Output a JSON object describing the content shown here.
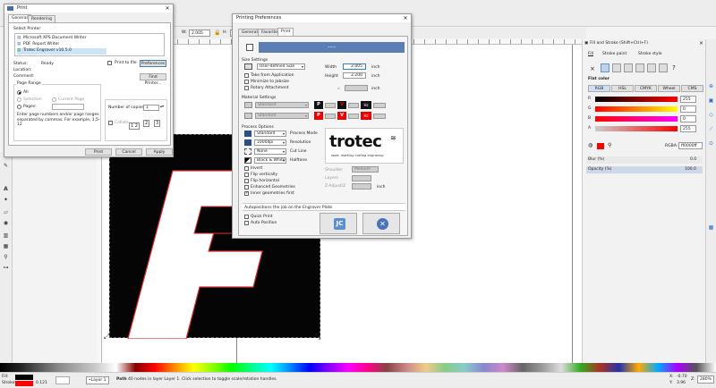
{
  "editor": {
    "toolbar": {
      "w_label": "W:",
      "w_value": "2.005"
    },
    "statusbar": {
      "fill_label": "Fill:",
      "stroke_label": "Stroke:",
      "stroke_width": "0.121",
      "layer": "•Layer 1",
      "message_bold": "Path",
      "message": " 40 nodes in layer Layer 1. Click selection to toggle scale/rotation handles.",
      "x_label": "X:",
      "x_value": "-0.70",
      "y_label": "Y:",
      "y_value": "3.96",
      "z_label": "Z:",
      "zoom": "280%"
    }
  },
  "print_dialog": {
    "title": "Print",
    "tabs": [
      "General",
      "Rendering"
    ],
    "select_printer_label": "Select Printer",
    "printers": [
      {
        "name": "Microsoft XPS Document Writer"
      },
      {
        "name": "PDF Report Writer"
      },
      {
        "name": "Trotec Engraver v10.5.0"
      }
    ],
    "status_label": "Status:",
    "status_value": "Ready",
    "location_label": "Location:",
    "comment_label": "Comment:",
    "print_to_file": "Print to file",
    "preferences_btn": "Preferences",
    "find_printer_btn": "Find Printer...",
    "page_range_label": "Page Range",
    "range_all": "All",
    "range_selection": "Selection",
    "range_current": "Current Page",
    "range_pages": "Pages:",
    "range_help": "Enter page numbers and/or page ranges separated by commas.  For example, 1,5-12",
    "copies_label": "Number of copies:",
    "copies_value": "1",
    "collate_label": "Collate",
    "print_btn": "Print",
    "cancel_btn": "Cancel",
    "apply_btn": "Apply"
  },
  "prefs_dialog": {
    "title": "Printing Preferences",
    "tabs": [
      "General",
      "Favorites",
      "Print"
    ],
    "size_settings_label": "Size Settings",
    "size_mode": "User-defined Size",
    "width_label": "Width",
    "width_value": "2.005",
    "width_unit": "inch",
    "height_label": "Height",
    "height_value": "2.200",
    "height_unit": "inch",
    "take_from_app": "Take from Application",
    "minimize_jobsize": "Minimize to Jobsize",
    "rotary_attachment": "Rotary Attachment",
    "rotary_unit": "inch",
    "material_settings_label": "Material Settings",
    "material_1": "Standard",
    "material_2": "Standard",
    "process_options_label": "Process Options",
    "process_mode_value": "Standard",
    "process_mode_label": "Process Mode",
    "resolution_value": "1000dpi",
    "resolution_label": "Resolution",
    "cut_line_value": "None",
    "cut_line_label": "Cut Line",
    "halftone_value": "Black & White",
    "halftone_label": "Halftone",
    "invert": "Invert",
    "flip_vertically": "Flip vertically",
    "flip_horizontal": "Flip horizontal",
    "enhanced_geometries": "Enhanced Geometries",
    "inner_geometries_first": "Inner geometries first",
    "shoulder_label": "Shoulder",
    "shoulder_value": "Medium",
    "layers_label": "Layers",
    "z_offset_label": "Z-Adjust/Z",
    "z_offset_unit": "inch",
    "logo_text": "trotec",
    "logo_tagline": "laser. marking cutting engraving",
    "autoposition_label": "Autopositions the job on the Engraver Plate",
    "quick_print": "Quick Print",
    "auto_position": "Auto Position",
    "colors": {
      "accent": "#5b7fb4"
    }
  },
  "fill_stroke": {
    "title": "Fill and Stroke (Shift+Ctrl+F)",
    "tabs": [
      "Fill",
      "Stroke paint",
      "Stroke style"
    ],
    "flat_color_label": "Flat color",
    "modes": [
      "RGB",
      "HSL",
      "CMYK",
      "Wheel",
      "CMS"
    ],
    "channels": [
      {
        "label": "R",
        "value": "255",
        "color": "#e00000"
      },
      {
        "label": "G",
        "value": "0",
        "color": "#ff0000"
      },
      {
        "label": "B",
        "value": "0",
        "color": "#e000e0"
      },
      {
        "label": "A",
        "value": "255",
        "color": "#ff0000"
      }
    ],
    "rgba_label": "RGBA:",
    "rgba_value": "ff0000ff",
    "blur_label": "Blur (%)",
    "blur_value": "0.0",
    "opacity_label": "Opacity (%)",
    "opacity_value": "100.0"
  }
}
